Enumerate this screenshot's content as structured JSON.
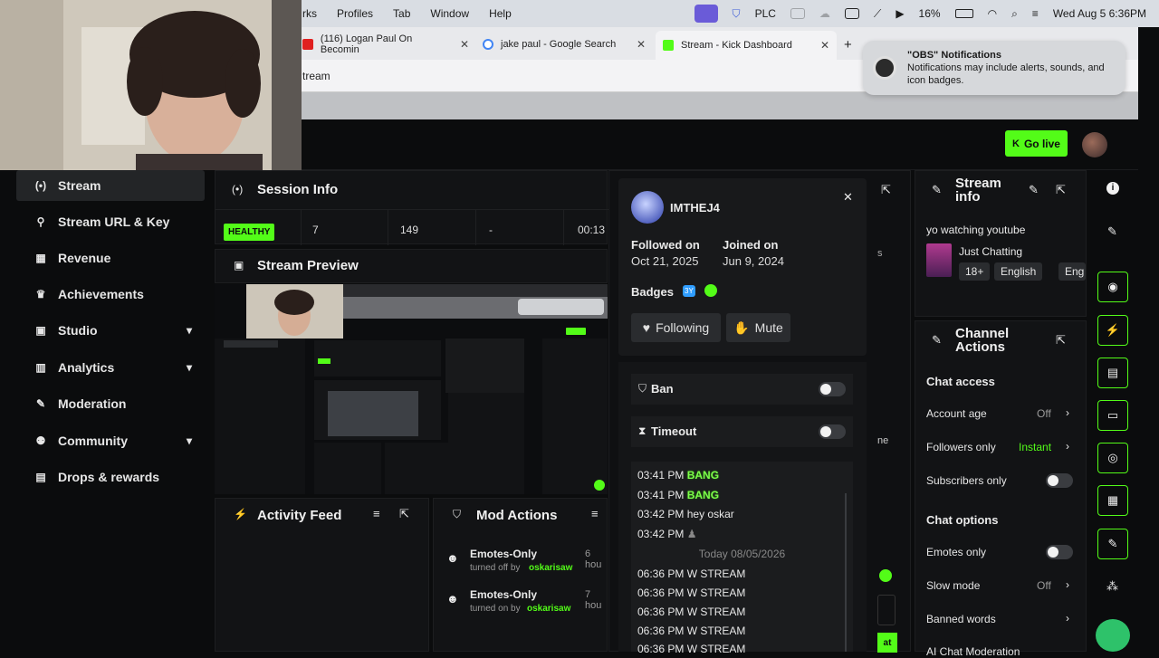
{
  "menubar": {
    "items": [
      "rks",
      "Profiles",
      "Tab",
      "Window",
      "Help"
    ],
    "right": {
      "plc": "PLC",
      "battery": "16%",
      "datetime": "Wed Aug 5  6:36PM"
    }
  },
  "browser": {
    "tabs": [
      {
        "label": "(116) Logan Paul On Becomin",
        "fav_color": "#e02020"
      },
      {
        "label": "jake paul - Google Search",
        "fav_color": "#4285f4"
      },
      {
        "label": "Stream - Kick Dashboard",
        "fav_color": "#53fc18"
      }
    ],
    "new_tab": "+",
    "url": "tream"
  },
  "notification": {
    "title": "\"OBS\" Notifications",
    "body": "Notifications may include alerts, sounds, and icon badges."
  },
  "topbar": {
    "go_live": "Go live"
  },
  "sidebar": {
    "items": [
      {
        "label": "Stream",
        "icon": "stream-icon",
        "glyph": "(•)"
      },
      {
        "label": "Stream URL & Key",
        "icon": "link-icon",
        "glyph": "⚲"
      },
      {
        "label": "Revenue",
        "icon": "revenue-icon",
        "glyph": "▦"
      },
      {
        "label": "Achievements",
        "icon": "trophy-icon",
        "glyph": "♛"
      },
      {
        "label": "Studio",
        "icon": "studio-icon",
        "glyph": "▣"
      },
      {
        "label": "Analytics",
        "icon": "analytics-icon",
        "glyph": "▥"
      },
      {
        "label": "Moderation",
        "icon": "wrench-icon",
        "glyph": "✎"
      },
      {
        "label": "Community",
        "icon": "community-icon",
        "glyph": "⚉"
      },
      {
        "label": "Drops & rewards",
        "icon": "drops-icon",
        "glyph": "▤"
      }
    ]
  },
  "session": {
    "title": "Session Info",
    "health": "HEALTHY",
    "stats": [
      "7",
      "149",
      "-",
      "00:13"
    ]
  },
  "preview": {
    "title": "Stream Preview"
  },
  "activity": {
    "title": "Activity Feed"
  },
  "mod_actions": {
    "title": "Mod Actions",
    "items": [
      {
        "title": "Emotes-Only",
        "action": "turned off by",
        "user": "oskarisaw",
        "time": "6 hou"
      },
      {
        "title": "Emotes-Only",
        "action": "turned on by",
        "user": "oskarisaw",
        "time": "7 hou"
      }
    ]
  },
  "user_card": {
    "username": "IMTHEJ4",
    "followed_label": "Followed on",
    "followed_value": "Oct 21, 2025",
    "joined_label": "Joined on",
    "joined_value": "Jun 9, 2024",
    "badges_label": "Badges",
    "badge_num": "3Y",
    "following_btn": "Following",
    "mute_btn": "Mute",
    "ban_label": "Ban",
    "timeout_label": "Timeout"
  },
  "chat": {
    "lines": [
      {
        "time": "03:41 PM",
        "text": "BANG",
        "emote": true
      },
      {
        "time": "03:41 PM",
        "text": "BANG",
        "emote": true
      },
      {
        "time": "03:42 PM",
        "text": "hey oskar",
        "emote": false
      },
      {
        "time": "03:42 PM",
        "text": "",
        "emote": false
      }
    ],
    "divider": "Today 08/05/2026",
    "later": [
      {
        "time": "06:36 PM",
        "text": "W STREAM"
      },
      {
        "time": "06:36 PM",
        "text": "W STREAM"
      },
      {
        "time": "06:36 PM",
        "text": "W STREAM"
      },
      {
        "time": "06:36 PM",
        "text": "W STREAM"
      },
      {
        "time": "06:36 PM",
        "text": "W STREAM"
      }
    ]
  },
  "stream_info": {
    "title": "Stream info",
    "stream_title": "yo watching youtube",
    "category": "Just Chatting",
    "tags": [
      "18+",
      "English",
      "Eng"
    ]
  },
  "channel_actions": {
    "title": "Channel Actions",
    "chat_access": "Chat access",
    "account_age": "Account age",
    "account_age_val": "Off",
    "followers_only": "Followers only",
    "followers_only_val": "Instant",
    "subscribers_only": "Subscribers only",
    "chat_options": "Chat options",
    "emotes_only": "Emotes only",
    "slow_mode": "Slow mode",
    "slow_mode_val": "Off",
    "banned_words": "Banned words",
    "ai_moderation": "AI Chat Moderation"
  },
  "partial": {
    "s": "s",
    "ne": "ne",
    "at": "at"
  },
  "colors": {
    "accent": "#53fc18",
    "bg": "#0b0c0d",
    "panel": "#121315"
  }
}
